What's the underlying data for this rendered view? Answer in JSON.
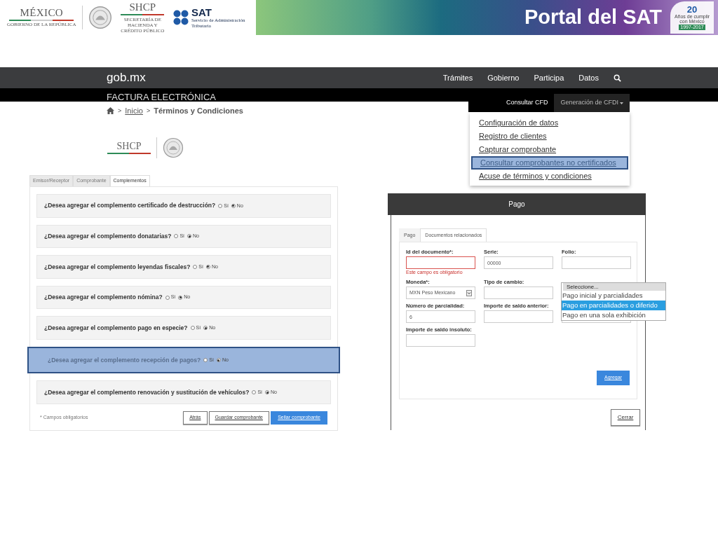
{
  "banner": {
    "logos": [
      {
        "kind": "mexico",
        "name": "MÉXICO",
        "subtitle": "GOBIERNO DE LA REPÚBLICA"
      },
      {
        "kind": "seal"
      },
      {
        "kind": "shcp",
        "name": "SHCP",
        "subtitle": "SECRETARÍA DE HACIENDA Y CRÉDITO PÚBLICO"
      },
      {
        "kind": "sat",
        "name": "SAT",
        "subtitle": "Servicio de Administración Tributaria"
      }
    ],
    "title": "Portal del SAT",
    "anniversary": {
      "number": "20",
      "caption": "Años de cumplir con México",
      "years": "1997-2017"
    }
  },
  "navbar": {
    "brand": "gob.mx",
    "links": [
      "Trámites",
      "Gobierno",
      "Participa",
      "Datos"
    ]
  },
  "section_bar": {
    "title": "FACTURA ELECTRÓNICA",
    "menu": [
      {
        "label": "Consultar CFD",
        "selected": false
      },
      {
        "label": "Generación de CFDI",
        "selected": true
      }
    ]
  },
  "dropdown_menu": {
    "items": [
      {
        "label": "Configuración de datos",
        "selected": false
      },
      {
        "label": "Registro de clientes",
        "selected": false
      },
      {
        "label": "Capturar comprobante",
        "selected": false
      },
      {
        "label": "Consultar comprobantes no certificados",
        "selected": true
      },
      {
        "label": "Acuse de términos y condiciones",
        "selected": false
      }
    ]
  },
  "breadcrumb": {
    "separator": ">",
    "items": [
      {
        "label": "Inicio",
        "kind": "link"
      },
      {
        "label": "Términos y Condiciones",
        "kind": "current"
      }
    ]
  },
  "page_logo": {
    "name": "SHCP"
  },
  "form": {
    "tabs": [
      {
        "label": "Emisor/Receptor",
        "selected": false
      },
      {
        "label": "Comprobante",
        "selected": false
      },
      {
        "label": "Complementos",
        "selected": true
      }
    ],
    "questions": [
      {
        "text": "¿Desea agregar el complemento certificado de destrucción?",
        "highlighted": false,
        "options": [
          {
            "label": "Sí",
            "checked": false
          },
          {
            "label": "No",
            "checked": true
          }
        ]
      },
      {
        "text": "¿Desea agregar el complemento donatarias?",
        "highlighted": false,
        "options": [
          {
            "label": "Sí",
            "checked": false
          },
          {
            "label": "No",
            "checked": true
          }
        ]
      },
      {
        "text": "¿Desea agregar el complemento leyendas fiscales?",
        "highlighted": false,
        "options": [
          {
            "label": "Sí",
            "checked": false
          },
          {
            "label": "No",
            "checked": true
          }
        ]
      },
      {
        "text": "¿Desea agregar el complemento nómina?",
        "highlighted": false,
        "options": [
          {
            "label": "Sí",
            "checked": false
          },
          {
            "label": "No",
            "checked": true
          }
        ]
      },
      {
        "text": "¿Desea agregar el complemento pago en especie?",
        "highlighted": false,
        "options": [
          {
            "label": "Sí",
            "checked": false
          },
          {
            "label": "No",
            "checked": true
          }
        ]
      },
      {
        "text": "¿Desea agregar el complemento recepción de pagos?",
        "highlighted": true,
        "options": [
          {
            "label": "Sí",
            "checked": false
          },
          {
            "label": "No",
            "checked": true
          }
        ]
      },
      {
        "text": "¿Desea agregar el complemento renovación y sustitución de vehículos?",
        "highlighted": false,
        "options": [
          {
            "label": "Sí",
            "checked": false
          },
          {
            "label": "No",
            "checked": true
          }
        ]
      }
    ],
    "note": "* Campos obligatorios",
    "buttons": [
      {
        "label": "Atrás",
        "kind": "default"
      },
      {
        "label": "Guardar comprobante",
        "kind": "default"
      },
      {
        "label": "Sellar comprobante",
        "kind": "primary"
      }
    ]
  },
  "modal": {
    "title": "Pago",
    "tabs": [
      {
        "label": "Pago",
        "selected": false
      },
      {
        "label": "Documentos relacionados",
        "selected": true
      }
    ],
    "fields": [
      {
        "kind": "text",
        "label": "Id del documento*:",
        "error": "Este campo es obligatorio"
      },
      {
        "kind": "text",
        "label": "Serie:",
        "value": "00000"
      },
      {
        "kind": "text",
        "label": "Folio:"
      },
      {
        "kind": "select",
        "label": "Moneda*:",
        "value": "MXN Peso Mexicano"
      },
      {
        "kind": "text",
        "label": "Tipo de cambio:"
      },
      {
        "kind": "gap"
      },
      {
        "kind": "text",
        "label": "Número de parcialidad:",
        "value": "6"
      },
      {
        "kind": "text",
        "label": "Importe de saldo anterior:"
      },
      {
        "kind": "text"
      },
      {
        "kind": "text",
        "label": "Importe de saldo insoluto:"
      }
    ],
    "listbox": {
      "header": "Seleccione...",
      "options": [
        {
          "label": "Pago inicial y parcialidades",
          "selected": false
        },
        {
          "label": "Pago en parcialidades o diferido",
          "selected": true
        },
        {
          "label": "Pago en una sola exhibición",
          "selected": false
        }
      ]
    },
    "add_button": "Agregar",
    "close_button": "Cerrar"
  }
}
